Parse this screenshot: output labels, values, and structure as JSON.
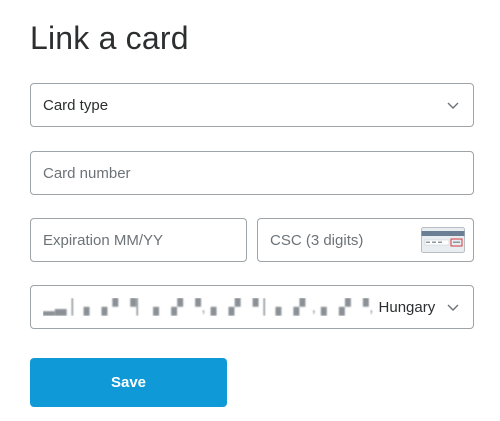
{
  "page": {
    "title": "Link a card"
  },
  "form": {
    "card_type": {
      "value": "Card type"
    },
    "card_number": {
      "placeholder": "Card number"
    },
    "expiration": {
      "placeholder": "Expiration MM/YY"
    },
    "csc": {
      "placeholder": "CSC (3 digits)",
      "card_icon": "csc-card-back-icon"
    },
    "address": {
      "country": "Hungary"
    },
    "save_label": "Save"
  },
  "colors": {
    "accent": "#0f9ad7",
    "border": "#9da3a6",
    "text": "#2c2e2f",
    "placeholder": "#6c7378"
  }
}
